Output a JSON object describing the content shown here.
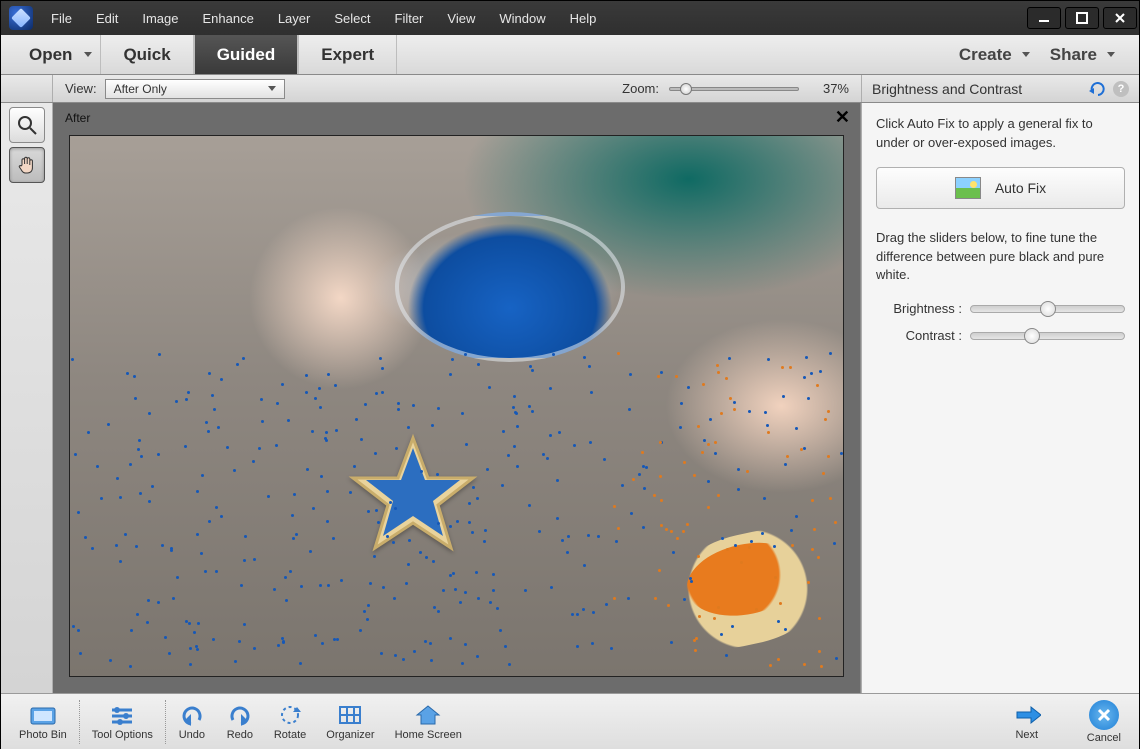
{
  "menu": {
    "items": [
      "File",
      "Edit",
      "Image",
      "Enhance",
      "Layer",
      "Select",
      "Filter",
      "View",
      "Window",
      "Help"
    ]
  },
  "modebar": {
    "open": "Open",
    "tabs": [
      "Quick",
      "Guided",
      "Expert"
    ],
    "active_tab": "Guided",
    "create": "Create",
    "share": "Share"
  },
  "secondbar": {
    "view_label": "View:",
    "view_value": "After Only",
    "zoom_label": "Zoom:",
    "zoom_value": "37%",
    "zoom_pos_pct": 8
  },
  "canvas": {
    "label": "After"
  },
  "panel": {
    "title": "Brightness and Contrast",
    "help1": "Click Auto Fix to apply a general fix to under or over-exposed images.",
    "autofix": "Auto Fix",
    "help2": "Drag the sliders below, to fine tune the difference between pure black and pure white.",
    "brightness_label": "Brightness :",
    "brightness_pos_pct": 50,
    "contrast_label": "Contrast :",
    "contrast_pos_pct": 40
  },
  "bottombar": {
    "items": [
      "Photo Bin",
      "Tool Options",
      "Undo",
      "Redo",
      "Rotate",
      "Organizer",
      "Home Screen"
    ],
    "next": "Next",
    "cancel": "Cancel"
  }
}
